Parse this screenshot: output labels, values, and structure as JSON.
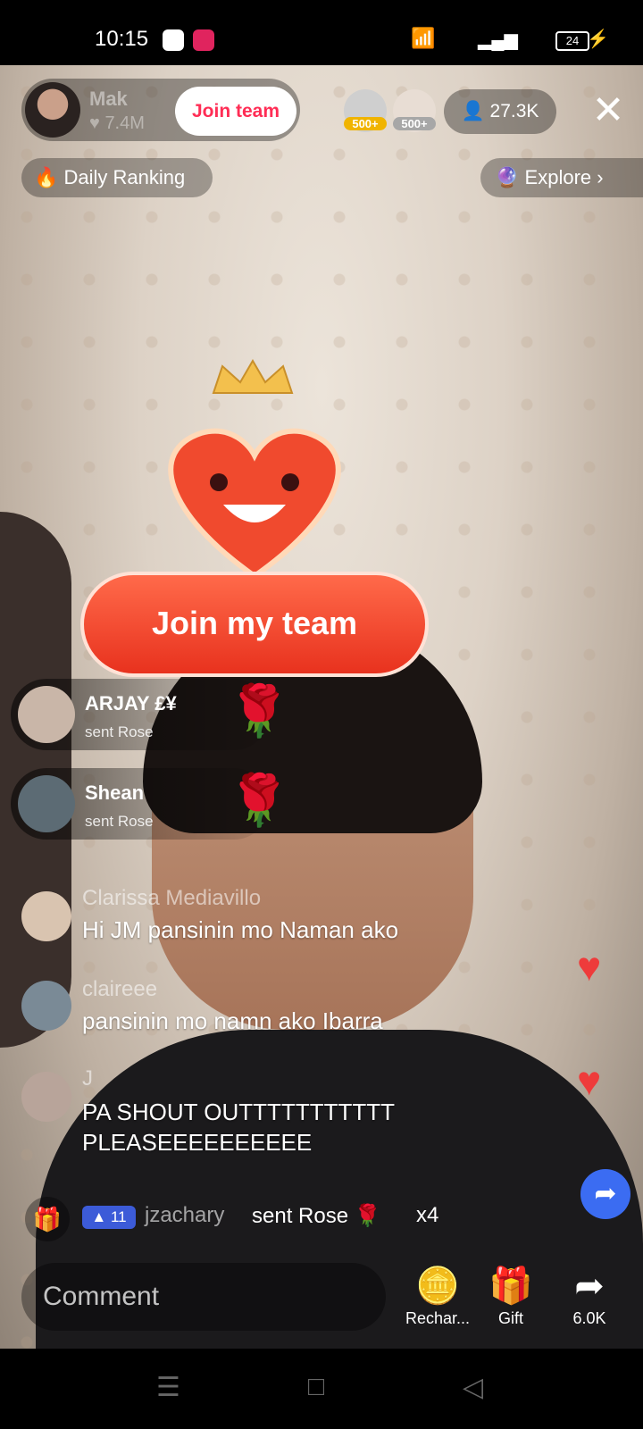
{
  "status_bar": {
    "time": "10:15",
    "battery": "24"
  },
  "header": {
    "host_name": "Mak",
    "host_likes": "7.4M",
    "join_team_label": "Join team",
    "gift_badges": [
      "500+",
      "500+"
    ],
    "viewers": "27.3K"
  },
  "subheader": {
    "daily_ranking": "Daily Ranking",
    "explore": "Explore"
  },
  "promo": {
    "join_my_team": "Join my team"
  },
  "gift_notifications": [
    {
      "user": "ARJAY £¥",
      "action": "sent Rose"
    },
    {
      "user": "Shean",
      "action": "sent Rose"
    }
  ],
  "comments": [
    {
      "user": "Clarissa Mediavillo",
      "text": "Hi JM pansinin mo Naman ako"
    },
    {
      "user": "claireee",
      "text": "pansinin mo namn ako Ibarra"
    },
    {
      "user": "J",
      "text": "PA SHOUT OUTTTTTTTTTTT PLEASEEEEEEEEEE"
    }
  ],
  "gift_line": {
    "level": "11",
    "user": "jzachary",
    "text": "sent Rose",
    "count": "x4"
  },
  "bottom_bar": {
    "comment_placeholder": "Comment",
    "recharge": "Rechar...",
    "gift": "Gift",
    "share_count": "6.0K"
  }
}
